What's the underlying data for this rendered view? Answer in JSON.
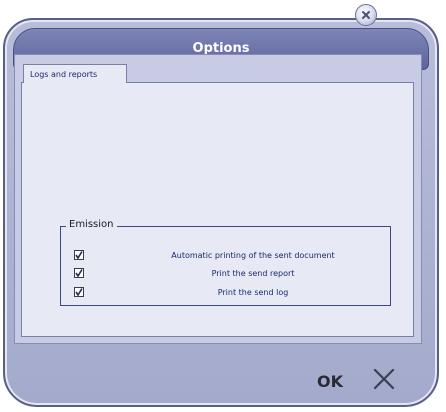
{
  "window": {
    "title": "Options"
  },
  "tabs": [
    {
      "label": "Logs and reports",
      "active": true
    }
  ],
  "emission": {
    "legend": "Emission",
    "options": [
      {
        "label": "Automatic printing of the sent document",
        "checked": true
      },
      {
        "label": "Print the send report",
        "checked": true
      },
      {
        "label": "Print the send log",
        "checked": true
      }
    ]
  },
  "buttons": {
    "ok_label": "OK",
    "cancel_icon": "close-x-icon"
  },
  "colors": {
    "title_bar": "#5d649b",
    "window_frame": "#a3aacb",
    "panel": "#e7e9f5",
    "label_text": "#1c2a6b"
  }
}
